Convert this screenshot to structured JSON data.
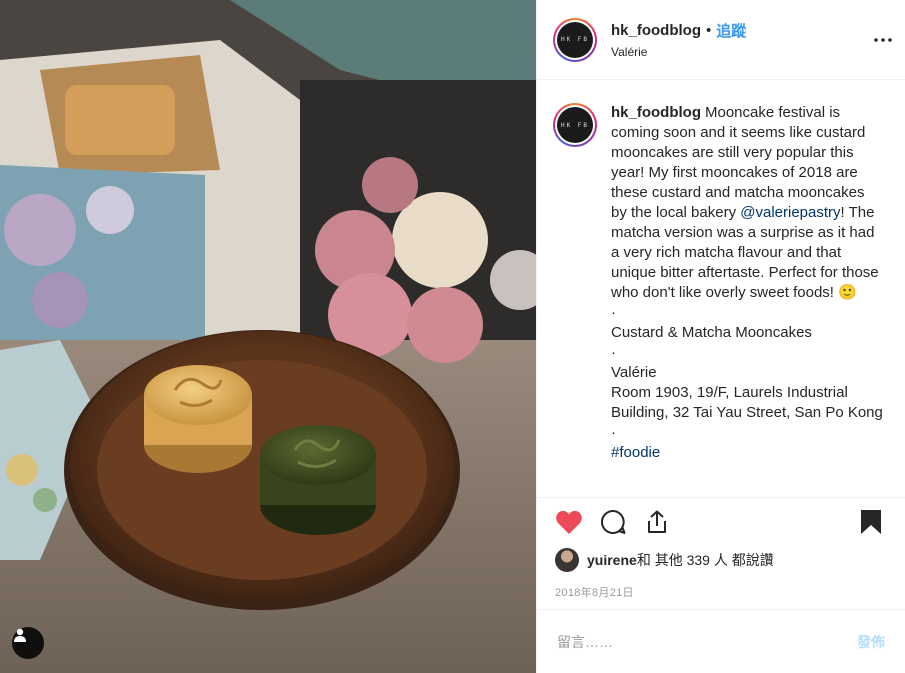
{
  "post": {
    "author": "hk_foodblog",
    "follow_label": "追蹤",
    "location": "Valérie",
    "avatar_text": "HK FB",
    "caption": {
      "username": "hk_foodblog",
      "text_before_mention": "Mooncake festival is coming soon and it seems like custard mooncakes are still very popular this year! My first mooncakes of 2018 are these custard and matcha mooncakes by the local bakery ",
      "mention": "@valeriepastry",
      "text_after_mention": "! The matcha version was a surprise as it had a very rich matcha flavour and that unique bitter aftertaste. Perfect for those who don't like overly sweet foods! 🙂",
      "lines": [
        "·",
        "Custard & Matcha Mooncakes",
        "·",
        "Valérie",
        "Room 1903, 19/F, Laurels Industrial Building, 32 Tai Yau Street, San Po Kong",
        "·",
        "#foodie"
      ]
    },
    "likes": {
      "user": "yuirene",
      "text": " 和 其他 339 人 都說讚"
    },
    "date": "2018年8月21日",
    "comment": {
      "placeholder": "留言……",
      "post_label": "發佈"
    }
  },
  "icons": {
    "more": "more-options-icon",
    "like": "heart-icon",
    "comment": "comment-icon",
    "share": "share-icon",
    "save": "bookmark-icon",
    "user_tag": "user-tag-icon"
  },
  "colors": {
    "accent": "#3897f0",
    "like_red": "#ed4956",
    "mention": "#003569"
  }
}
